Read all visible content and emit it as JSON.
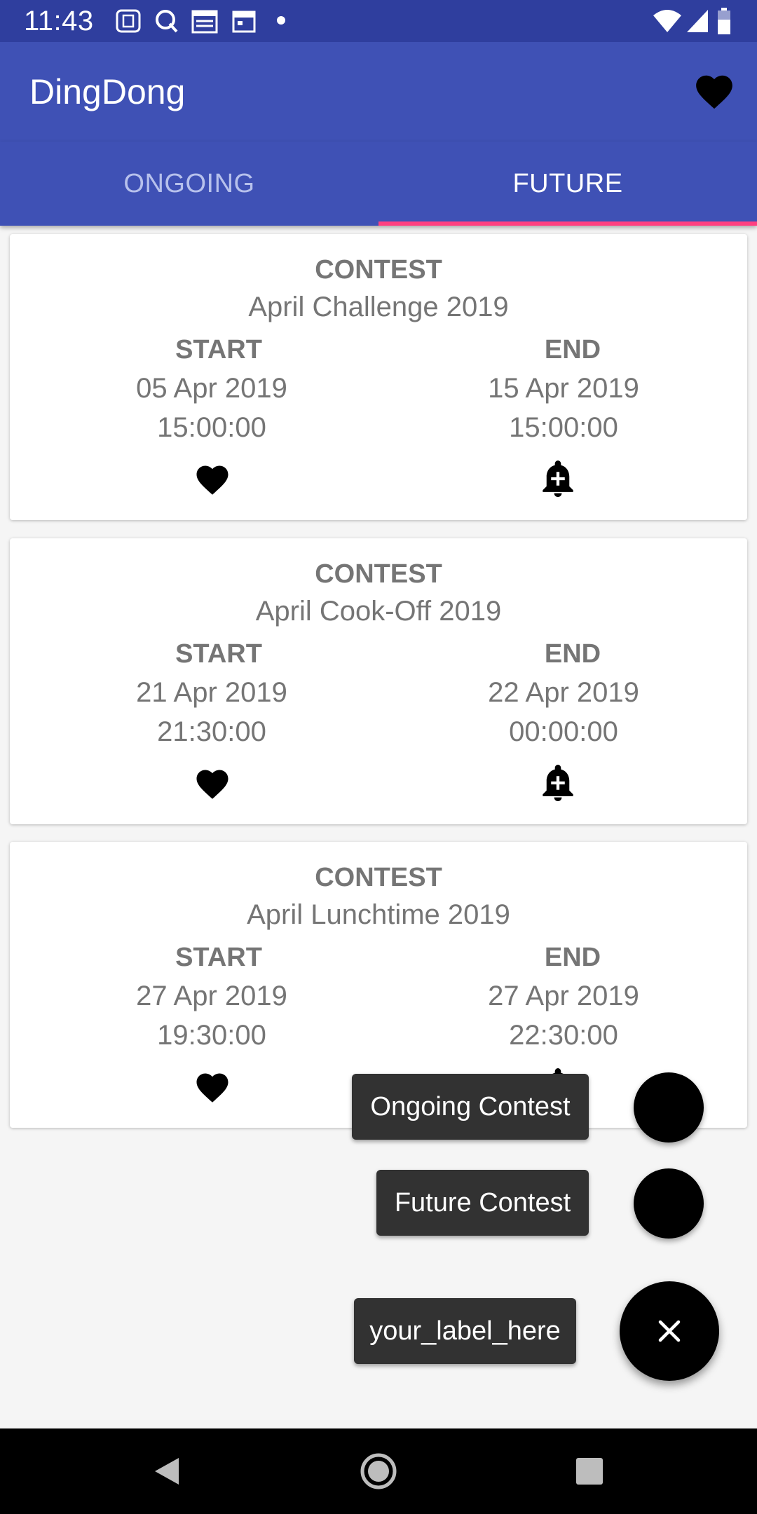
{
  "status_bar": {
    "time": "11:43",
    "left_icons": [
      "sim-icon",
      "search-q-icon",
      "news-icon",
      "calendar-icon",
      "dot-icon"
    ],
    "right_icons": [
      "wifi-icon",
      "signal-icon",
      "battery-icon"
    ]
  },
  "app_bar": {
    "title": "DingDong",
    "favorite_icon": "heart-icon"
  },
  "tabs": [
    {
      "label": "ONGOING",
      "selected": false
    },
    {
      "label": "FUTURE",
      "selected": true
    }
  ],
  "labels": {
    "contest": "CONTEST",
    "start": "START",
    "end": "END"
  },
  "contests": [
    {
      "name": "April Challenge 2019",
      "start_date": "05 Apr 2019",
      "start_time": "15:00:00",
      "end_date": "15 Apr 2019",
      "end_time": "15:00:00"
    },
    {
      "name": "April Cook-Off 2019",
      "start_date": "21 Apr 2019",
      "start_time": "21:30:00",
      "end_date": "22 Apr 2019",
      "end_time": "00:00:00"
    },
    {
      "name": "April Lunchtime 2019",
      "start_date": "27 Apr 2019",
      "start_time": "19:30:00",
      "end_date": "27 Apr 2019",
      "end_time": "22:30:00"
    }
  ],
  "fab_menu": {
    "ongoing_label": "Ongoing Contest",
    "future_label": "Future Contest",
    "main_label": "your_label_here",
    "main_icon": "close-icon"
  },
  "colors": {
    "primary": "#3f51b5",
    "primary_dark": "#2f3e9e",
    "accent": "#ff4081"
  }
}
